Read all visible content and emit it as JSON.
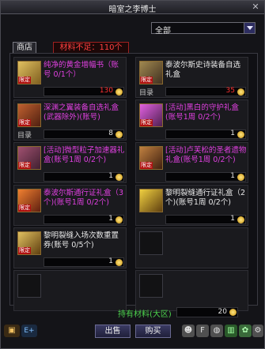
{
  "window": {
    "title": "暗室之李博士"
  },
  "filter": {
    "selected": "全部"
  },
  "tab": {
    "label": "商店"
  },
  "warning": "材料不足：110个",
  "items": [
    {
      "name": "纯净的黄金增幅书（账号 0/1个）",
      "price": "130",
      "price_red": true,
      "badge": "限定",
      "catalog": "",
      "color": "#c8a040"
    },
    {
      "name": "泰波尔斯史诗装备自选礼盒",
      "price": "35",
      "price_red": true,
      "badge": "限定",
      "catalog": "目录",
      "color": "#8a7040"
    },
    {
      "name": "深渊之翼装备自选礼盒(武器除外)(账号)",
      "price": "8",
      "price_red": false,
      "badge": "限定",
      "catalog": "目录",
      "color": "#b05020"
    },
    {
      "name": "[活动]黑白的守护礼盒(账号1周 0/2个)",
      "price": "1",
      "price_red": false,
      "badge": "限定",
      "catalog": "",
      "color": "#c040c0"
    },
    {
      "name": "[活动]微型粒子加速器礼盒(账号1周 0/2个)",
      "price": "1",
      "price_red": false,
      "badge": "限定",
      "catalog": "",
      "color": "#804060"
    },
    {
      "name": "[活动]卢芙松的圣者遗物礼盒(账号1周 0/2个)",
      "price": "1",
      "price_red": false,
      "badge": "限定",
      "catalog": "",
      "color": "#6a4030"
    },
    {
      "name": "泰波尔斯通行证礼盒（3个)(账号1周 0/2个)",
      "price": "1",
      "price_red": false,
      "badge": "限定",
      "catalog": "",
      "color": "#d06020"
    },
    {
      "name": "黎明裂缝通行证礼盒（2个)(账号1周 0/2个)",
      "price": "1",
      "price_red": false,
      "badge": "",
      "catalog": "",
      "color": "#c0a020"
    },
    {
      "name": "黎明裂缝入场次数重置券(账号 0/5个)",
      "price": "1",
      "price_red": false,
      "badge": "限定",
      "catalog": "",
      "color": "#c0a040"
    }
  ],
  "owned": {
    "label": "持有材料(大区)",
    "value": "20"
  },
  "buttons": {
    "sell": "出售",
    "buy": "购买"
  },
  "bottom_left": "E+"
}
